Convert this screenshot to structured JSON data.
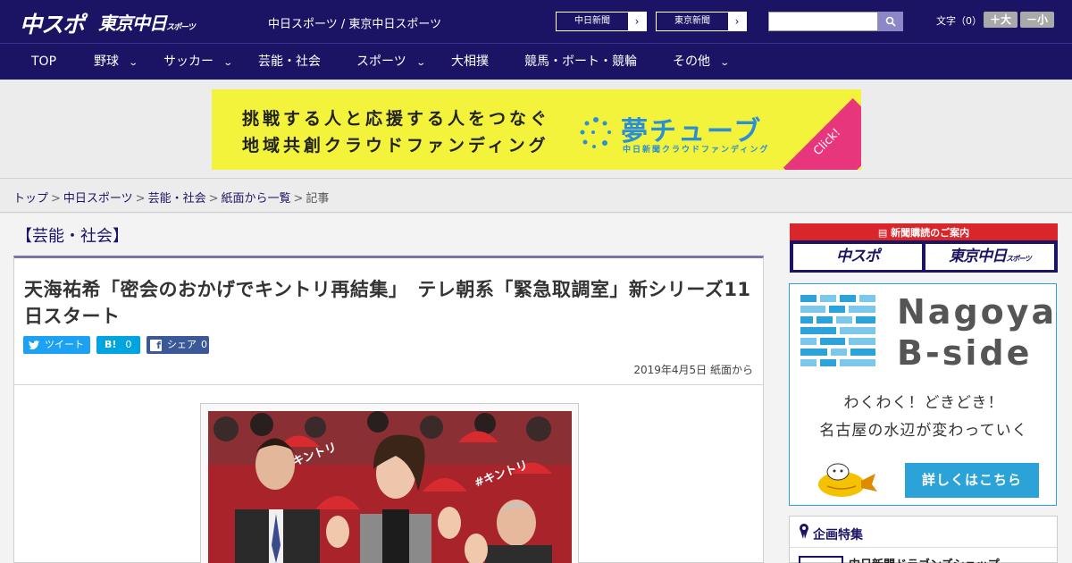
{
  "header": {
    "logo_chunichi": "中スポ",
    "logo_tokyo": "東京中日",
    "logo_tokyo_suffix": "スポーツ",
    "site_label": "中日スポーツ / 東京中日スポーツ",
    "btn_chunichi": "中日新聞",
    "btn_tokyo": "東京新聞",
    "search_placeholder": "",
    "text_size_label": "文字（0）",
    "size_up": "＋大",
    "size_down": "－小"
  },
  "nav": {
    "items": [
      {
        "label": "TOP",
        "dropdown": false
      },
      {
        "label": "野球",
        "dropdown": true
      },
      {
        "label": "サッカー",
        "dropdown": true
      },
      {
        "label": "芸能・社会",
        "dropdown": false
      },
      {
        "label": "スポーツ",
        "dropdown": true
      },
      {
        "label": "大相撲",
        "dropdown": false
      },
      {
        "label": "競馬・ボート・競輪",
        "dropdown": false
      },
      {
        "label": "その他",
        "dropdown": true
      }
    ]
  },
  "banner": {
    "line1": "挑戦する人と応援する人をつなぐ",
    "line2": "地域共創クラウドファンディング",
    "title": "夢チューブ",
    "subtitle": "中日新聞クラウドファンディング",
    "click": "Click!"
  },
  "breadcrumb": {
    "items": [
      "トップ",
      "中日スポーツ",
      "芸能・社会",
      "紙面から一覧"
    ],
    "current": "記事",
    "separator": ">"
  },
  "article": {
    "category": "【芸能・社会】",
    "title": "天海祐希「密会のおかげでキントリ再結集」　テレ朝系「緊急取調室」新シリーズ11日スタート",
    "tweet_label": "ツイート",
    "hatena_label": "B!",
    "hatena_count": "0",
    "facebook_label": "シェア",
    "facebook_count": "0",
    "date": "2019年4月5日 紙面から",
    "fan_text": "#キントリ"
  },
  "sidebar": {
    "subscribe_header": "新聞購読のご案内",
    "subscribe_chunichi": "中スポ",
    "subscribe_tokyo": "東京中日",
    "subscribe_tokyo_suffix": "スポーツ",
    "bside_line1": "Nagoya",
    "bside_line2": "B-side",
    "bside_text1": "わくわく！どきどき！",
    "bside_text2": "名古屋の水辺が変わっていく",
    "bside_button": "詳しくはこちら",
    "feature_title": "企画特集",
    "feature_item": "中日新聞ドラゴンズショップ"
  },
  "colors": {
    "header_bg": "#1b1464",
    "accent_red": "#d9262a",
    "twitter": "#1da1f2",
    "hatena": "#00a4de",
    "facebook": "#3b5998",
    "bside_blue": "#2ba3d8",
    "banner_yellow": "#f2f33a"
  }
}
